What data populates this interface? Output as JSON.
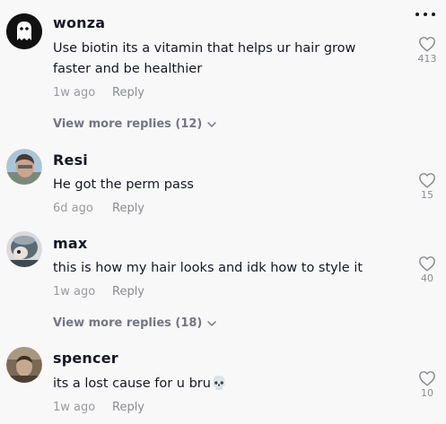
{
  "more_icon": "more-horizontal-icon",
  "like_icon": "heart-outline-icon",
  "comments": [
    {
      "username": "wonza",
      "text": "Use biotin its a vitamin that helps ur hair grow faster and be healthier",
      "time": "1w ago",
      "reply": "Reply",
      "likes": "413",
      "view_more": "View more replies (12)"
    },
    {
      "username": "Resi",
      "text": "He got the perm pass",
      "time": "6d ago",
      "reply": "Reply",
      "likes": "15"
    },
    {
      "username": "max",
      "text": "this is how my hair looks and idk how to style it",
      "time": "1w ago",
      "reply": "Reply",
      "likes": "40",
      "view_more": "View more replies (18)"
    },
    {
      "username": "spencer",
      "text": "its a lost cause for u bru💀",
      "time": "1w ago",
      "reply": "Reply",
      "likes": "10"
    }
  ]
}
